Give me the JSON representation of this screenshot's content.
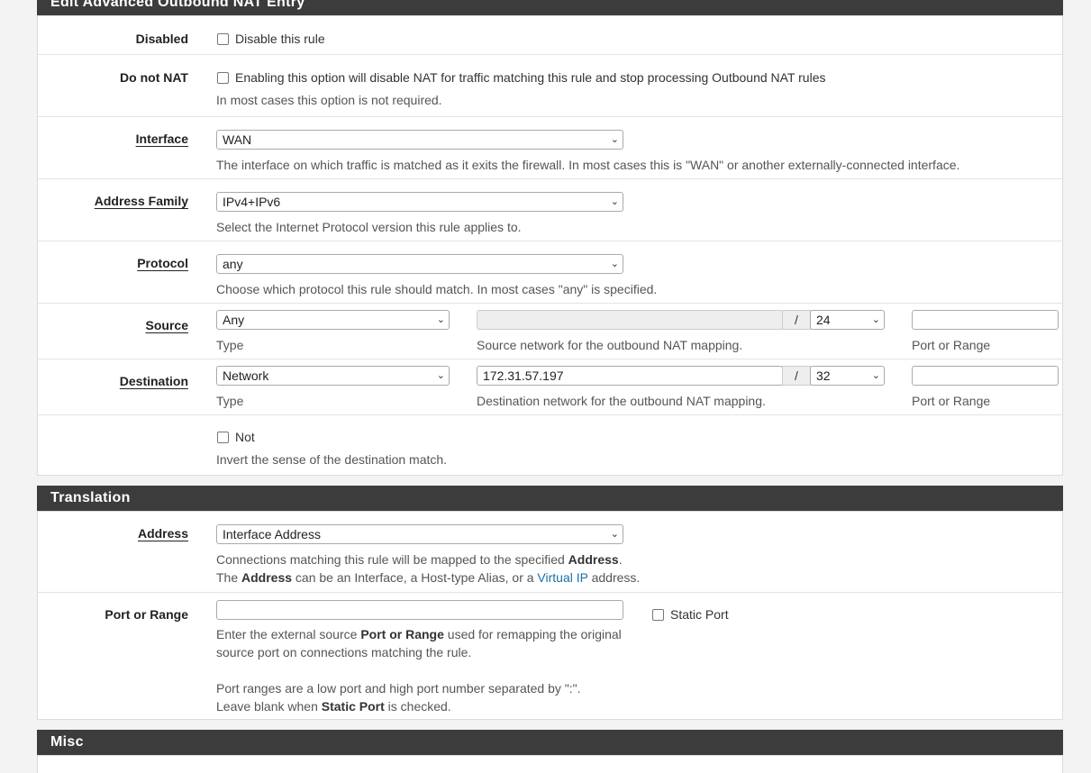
{
  "panels": {
    "edit_title": "Edit Advanced Outbound NAT Entry",
    "translation_title": "Translation",
    "misc_title": "Misc"
  },
  "disabled": {
    "label": "Disabled",
    "checkbox_label": "Disable this rule",
    "checked": false
  },
  "nonat": {
    "label": "Do not NAT",
    "checkbox_label": "Enabling this option will disable NAT for traffic matching this rule and stop processing Outbound NAT rules",
    "help": "In most cases this option is not required.",
    "checked": false
  },
  "interface": {
    "label": "Interface",
    "value": "WAN",
    "help": "The interface on which traffic is matched as it exits the firewall. In most cases this is \"WAN\" or another externally-connected interface."
  },
  "address_family": {
    "label": "Address Family",
    "value": "IPv4+IPv6",
    "help": "Select the Internet Protocol version this rule applies to."
  },
  "protocol": {
    "label": "Protocol",
    "value": "any",
    "help": "Choose which protocol this rule should match. In most cases \"any\" is specified."
  },
  "source": {
    "label": "Source",
    "type_value": "Any",
    "type_help": "Type",
    "network_value": "",
    "slash": "/",
    "mask": "24",
    "network_help": "Source network for the outbound NAT mapping.",
    "port_value": "",
    "port_help": "Port or Range"
  },
  "destination": {
    "label": "Destination",
    "type_value": "Network",
    "type_help": "Type",
    "network_value": "172.31.57.197",
    "slash": "/",
    "mask": "32",
    "network_help": "Destination network for the outbound NAT mapping.",
    "port_value": "",
    "port_help": "Port or Range"
  },
  "not": {
    "checkbox_label": "Not",
    "help": "Invert the sense of the destination match.",
    "checked": false
  },
  "translation_address": {
    "label": "Address",
    "value": "Interface Address",
    "help1_pre": "Connections matching this rule will be mapped to the specified ",
    "help1_bold": "Address",
    "help1_post": ".",
    "help2_pre": "The ",
    "help2_bold": "Address",
    "help2_mid": " can be an Interface, a Host-type Alias, or a ",
    "help2_link": "Virtual IP",
    "help2_post": " address."
  },
  "port_range": {
    "label": "Port or Range",
    "value": "",
    "static_port_label": "Static Port",
    "static_checked": false,
    "help1_pre": "Enter the external source ",
    "help1_bold": "Port or Range",
    "help1_post": " used for remapping the original",
    "help2": "source port on connections matching the rule.",
    "help3": "Port ranges are a low port and high port number separated by \":\".",
    "help4_pre": "Leave blank when ",
    "help4_bold": "Static Port",
    "help4_post": " is checked."
  }
}
